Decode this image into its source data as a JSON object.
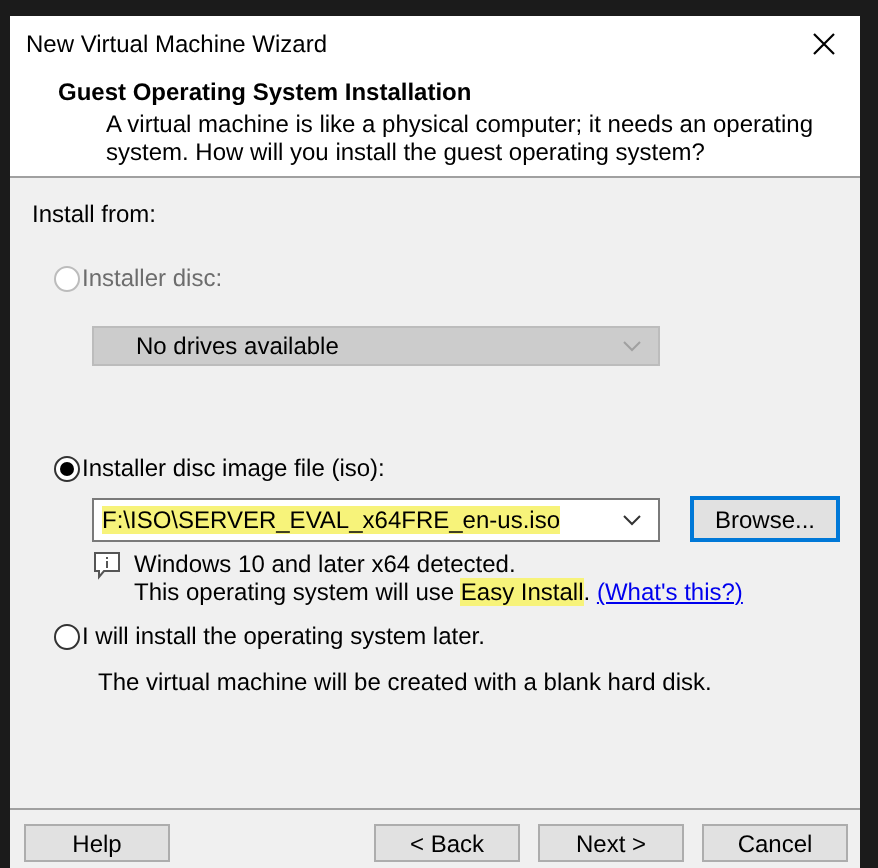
{
  "window": {
    "title": "New Virtual Machine Wizard"
  },
  "header": {
    "title": "Guest Operating System Installation",
    "description": "A virtual machine is like a physical computer; it needs an operating system. How will you install the guest operating system?"
  },
  "install_from_label": "Install from:",
  "options": [
    {
      "kind": "disc",
      "label": "Installer disc:",
      "selected": false,
      "disabled": true,
      "dropdown": {
        "value": "No drives available"
      }
    },
    {
      "kind": "iso",
      "label": "Installer disc image file (iso):",
      "selected": true,
      "disabled": false,
      "combobox": {
        "value": "F:\\ISO\\SERVER_EVAL_x64FRE_en-us.iso",
        "highlighted": true
      },
      "browse_button": {
        "label": "Browse...",
        "focused": true
      },
      "info": {
        "line1": "Windows 10 and later x64 detected.",
        "parts": [
          {
            "text": "This operating system will use ",
            "highlighted": false
          },
          {
            "text": "Easy Install",
            "highlighted": true
          },
          {
            "text": ".",
            "highlighted": false
          }
        ],
        "link": "(What's this?)"
      }
    },
    {
      "kind": "later",
      "label": "I will install the operating system later.",
      "selected": false,
      "disabled": false,
      "note": "The virtual machine will be created with a blank hard disk."
    }
  ],
  "help_button": "Help",
  "nav_buttons": [
    "< Back",
    "Next >",
    "Cancel"
  ]
}
